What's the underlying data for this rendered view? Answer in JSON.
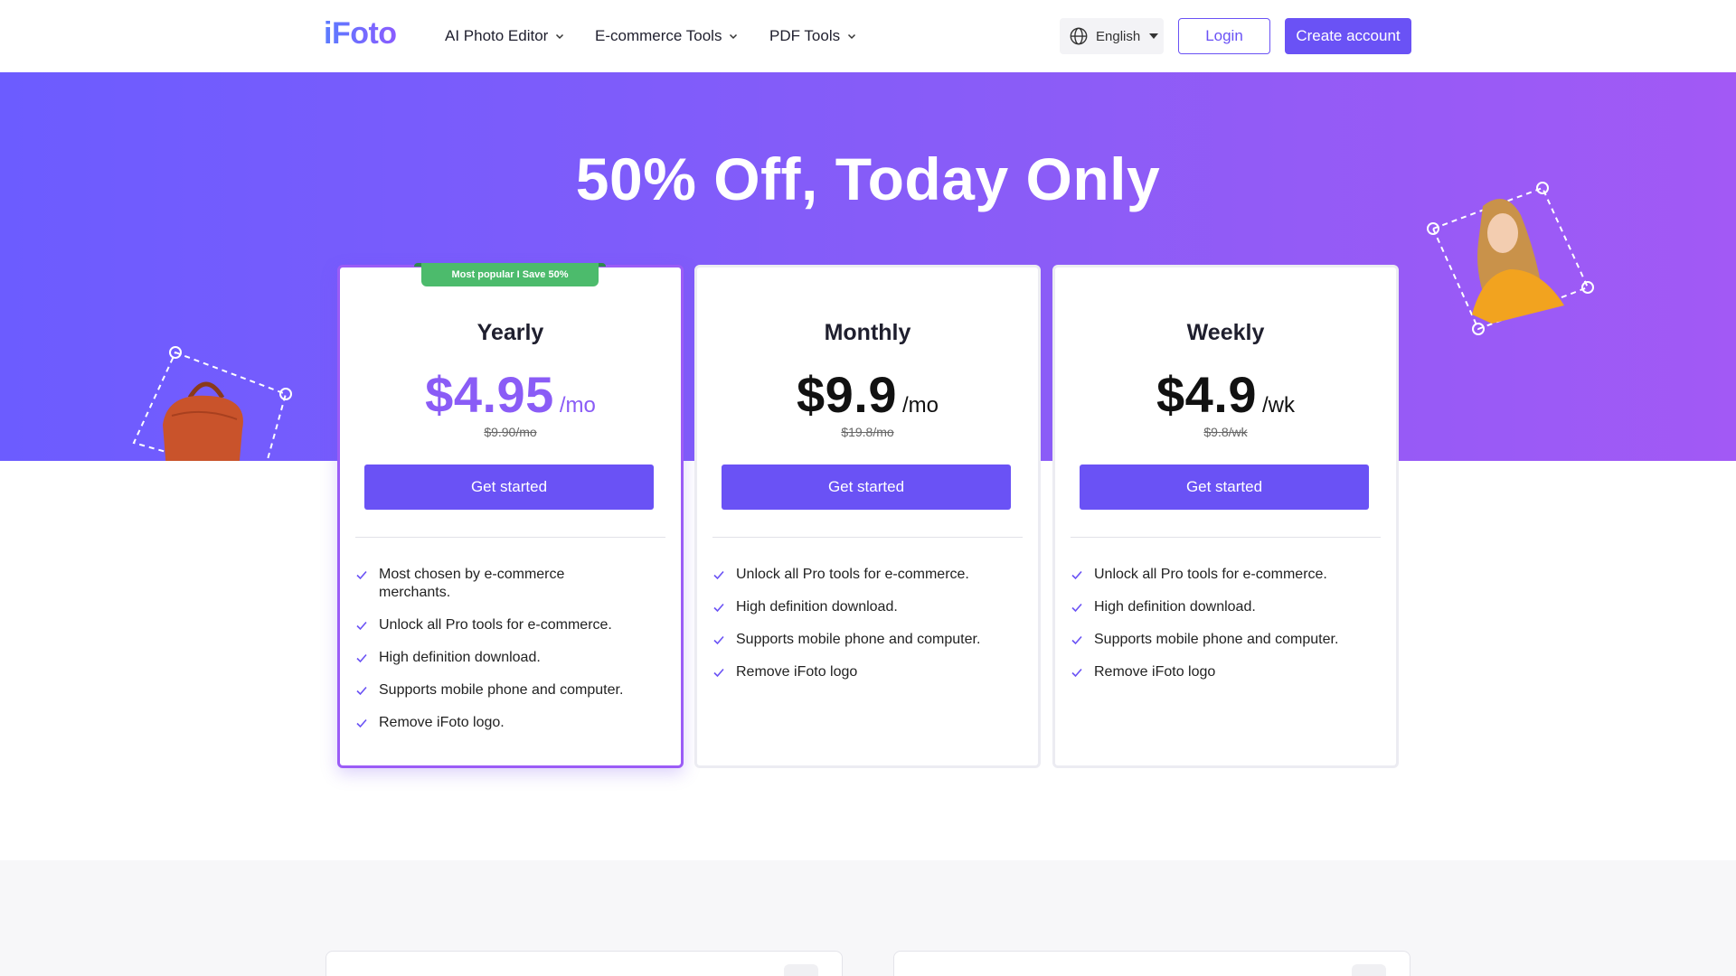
{
  "nav": {
    "logo": "iFoto",
    "menus": [
      {
        "label": "AI Photo Editor"
      },
      {
        "label": "E-commerce Tools"
      },
      {
        "label": "PDF Tools"
      }
    ],
    "language": "English",
    "login": "Login",
    "create_account": "Create account"
  },
  "hero": {
    "title": "50% Off, Today Only"
  },
  "plans": [
    {
      "name": "Yearly",
      "price": "$4.95",
      "per": "/mo",
      "old_price": "$9.90/mo",
      "badge": "Most popular I Save 50%",
      "cta": "Get started",
      "features": [
        "Most chosen by e-commerce merchants.",
        "Unlock all Pro tools for e-commerce.",
        "High definition download.",
        "Supports mobile phone and computer.",
        "Remove iFoto logo."
      ]
    },
    {
      "name": "Monthly",
      "price": "$9.9",
      "per": "/mo",
      "old_price": "$19.8/mo",
      "cta": "Get started",
      "features": [
        "Unlock all Pro tools for e-commerce.",
        "High definition download.",
        "Supports mobile phone and computer.",
        "Remove iFoto logo"
      ]
    },
    {
      "name": "Weekly",
      "price": "$4.9",
      "per": "/wk",
      "old_price": "$9.8/wk",
      "cta": "Get started",
      "features": [
        "Unlock all Pro tools for e-commerce.",
        "High definition download.",
        "Supports mobile phone and computer.",
        "Remove iFoto logo"
      ]
    }
  ],
  "colors": {
    "accent": "#6a52f5",
    "popular_border": "#9b5cf6",
    "badge": "#4cbb6c",
    "hero_start": "#6c5cff",
    "hero_end": "#a259f5"
  },
  "icons": [
    "chevron-down-icon",
    "globe-icon",
    "caret-down-icon",
    "check-icon",
    "handbag-image",
    "woman-photo-image"
  ]
}
